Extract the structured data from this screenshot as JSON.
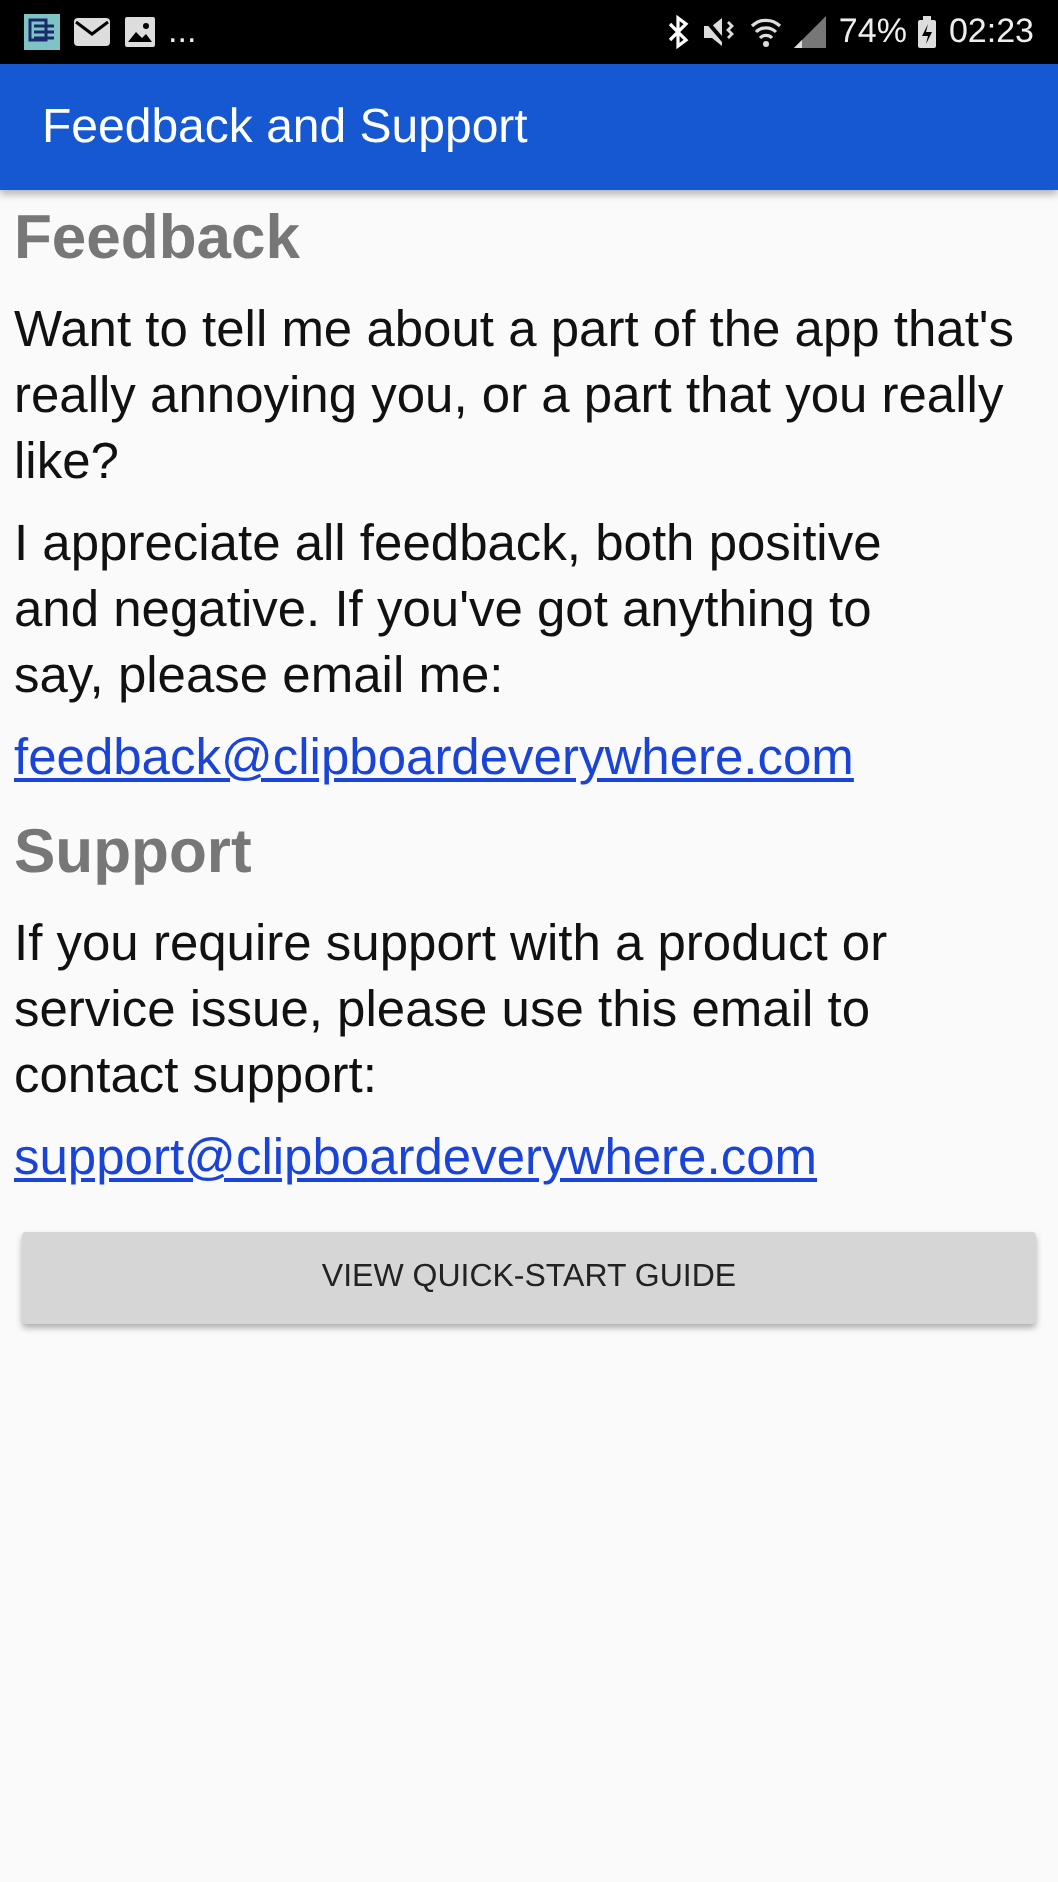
{
  "status_bar": {
    "overflow": "...",
    "battery": "74%",
    "time": "02:23"
  },
  "app_bar": {
    "title": "Feedback and Support"
  },
  "sections": [
    {
      "heading": "Feedback",
      "paragraphs": [
        "Want to tell me about a part of the app that's really annoying you, or a part that you really like?",
        "I appreciate all feedback, both positive and negative. If you've got anything to say, please email me:"
      ],
      "email": "feedback@clipboardeverywhere.com"
    },
    {
      "heading": "Support",
      "paragraphs": [
        "If you require support with a product or service issue, please use this email to contact support:"
      ],
      "email": "support@clipboardeverywhere.com"
    }
  ],
  "button": "VIEW QUICK-START GUIDE"
}
